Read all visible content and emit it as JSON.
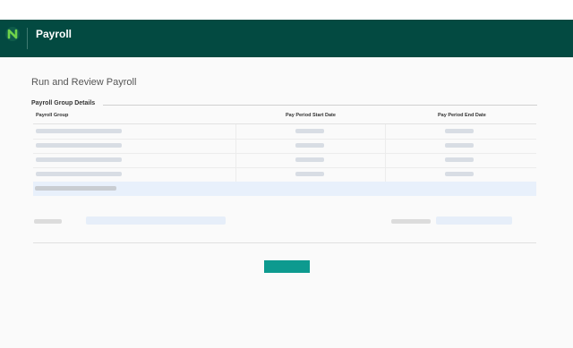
{
  "header": {
    "app_title": "Payroll",
    "logo_icon": "n-logo-icon",
    "color": "#034a41"
  },
  "main": {
    "page_title": "Run and Review Payroll",
    "section_title": "Payroll Group Details",
    "columns": [
      "Payroll Group",
      "Pay Period Start Date",
      "Pay Period End Date"
    ],
    "placeholder_rows": 4,
    "highlighted_row_color": "#e8f0fb",
    "action_button": {
      "label": "",
      "color": "#0d9a8f"
    }
  }
}
